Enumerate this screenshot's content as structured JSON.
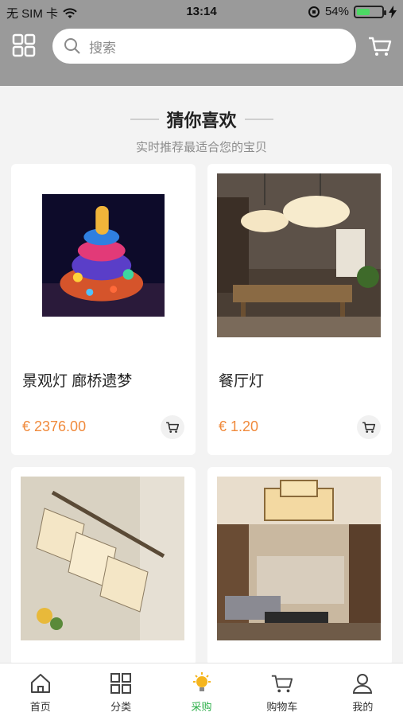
{
  "status": {
    "carrier": "无 SIM 卡",
    "time": "13:14",
    "battery": "54%",
    "battery_level": 0.54
  },
  "header": {
    "search_placeholder": "搜索"
  },
  "section": {
    "title": "猜你喜欢",
    "subtitle": "实时推荐最适合您的宝贝"
  },
  "products": [
    {
      "name": "景观灯 廊桥遗梦",
      "price": "€ 2376.00"
    },
    {
      "name": "餐厅灯",
      "price": "€ 1.20"
    },
    {
      "name": "",
      "price": ""
    },
    {
      "name": "",
      "price": ""
    }
  ],
  "tabs": [
    {
      "label": "首页",
      "icon": "home-icon"
    },
    {
      "label": "分类",
      "icon": "grid-icon"
    },
    {
      "label": "采购",
      "icon": "bulb-icon",
      "active": true
    },
    {
      "label": "购物车",
      "icon": "cart-icon"
    },
    {
      "label": "我的",
      "icon": "user-icon"
    }
  ],
  "colors": {
    "header_bg": "#9a9a9a",
    "price": "#f08a3c",
    "active_tab": "#2fb04b"
  }
}
